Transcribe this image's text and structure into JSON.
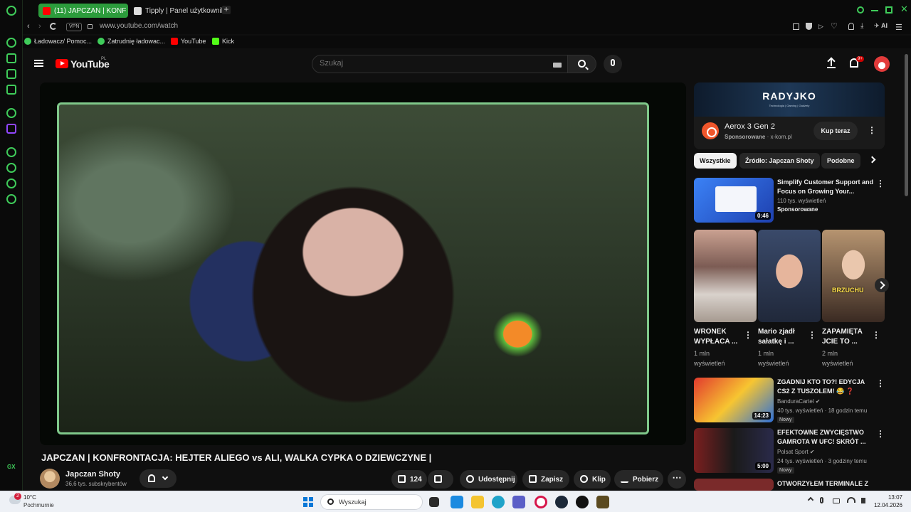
{
  "browser": {
    "tabs": [
      {
        "label": "(11) JAPCZAN | KONF",
        "active": true
      },
      {
        "label": "Tipply | Panel użytkownika",
        "active": false
      }
    ],
    "new_tab": "+",
    "vpn_label": "VPN",
    "url": "www.youtube.com/watch",
    "ai_label": "AI",
    "gx_label": "GX",
    "bookmarks": [
      "Ładowacz/ Pomoc...",
      "Zatrudnię ładowac...",
      "YouTube",
      "Kick"
    ],
    "accent_color": "#3fcc5a"
  },
  "youtube": {
    "logo_text": "YouTube",
    "region": "PL",
    "search_placeholder": "Szukaj",
    "notifications": "9+",
    "video": {
      "title": "JAPCZAN | KONFRONTACJA: HEJTER ALIEGO vs ALI, WALKA CYPKA O DZIEWCZYNE |",
      "channel": "Japczan Shoty",
      "subscribers": "36,6 tys. subskrybentów",
      "likes": "124",
      "actions": {
        "share": "Udostępnij",
        "save": "Zapisz",
        "clip": "Klip",
        "download": "Pobierz"
      }
    },
    "ad": {
      "brand": "RADYJKO",
      "tagline": "Technologia | Gaming | Gadżety",
      "product": "Aerox 3 Gen 2",
      "sponsored": "Sponsorowane",
      "advertiser": "x-kom.pl",
      "cta": "Kup teraz"
    },
    "chips": [
      "Wszystkie",
      "Źródło: Japczan Shoty",
      "Podobne"
    ],
    "recommended": [
      {
        "title_line1": "Simplify Customer Support and",
        "title_line2": "Focus on Growing Your...",
        "meta": "110 tys. wyświetleń",
        "meta2": "Sponsorowane",
        "duration": "0:46"
      },
      {
        "title_line1": "ZGADNIJ KTO TO?! EDYCJA",
        "title_line2": "CS2 Z TUSZOLEM! 😂 ❓",
        "meta": "BanduraCartel ✔",
        "meta2": "40 tys. wyświetleń · 18 godzin temu",
        "badge": "Nowy",
        "duration": "14:23"
      },
      {
        "title_line1": "EFEKTOWNE ZWYCIĘSTWO",
        "title_line2": "GAMROTA W UFC! SKRÓT ...",
        "meta": "Polsat Sport ✔",
        "meta2": "24 tys. wyświetleń · 3 godziny temu",
        "badge": "Nowy",
        "duration": "5:00"
      },
      {
        "title_line1": "OTWORZYŁEM TERMINALE Z"
      }
    ],
    "shorts": [
      {
        "title_line1": "WRONEK",
        "title_line2": "WYPŁACA ...",
        "views_line1": "1 mln",
        "views_line2": "wyświetleń"
      },
      {
        "title_line1": "Mario zjadł",
        "title_line2": "sałatkę i ...",
        "views_line1": "1 mln",
        "views_line2": "wyświetleń"
      },
      {
        "title_line1": "ZAPAMIĘTA",
        "title_line2": "JCIE TO ...",
        "views_line1": "2 mln",
        "views_line2": "wyświetleń",
        "caption": "BRZUCHU"
      }
    ]
  },
  "taskbar": {
    "weather_badge": "2",
    "temperature": "10°C",
    "weather": "Pochmurnie",
    "search_label": "Wyszukaj",
    "time": "13:07",
    "date": "12.04.2026"
  }
}
